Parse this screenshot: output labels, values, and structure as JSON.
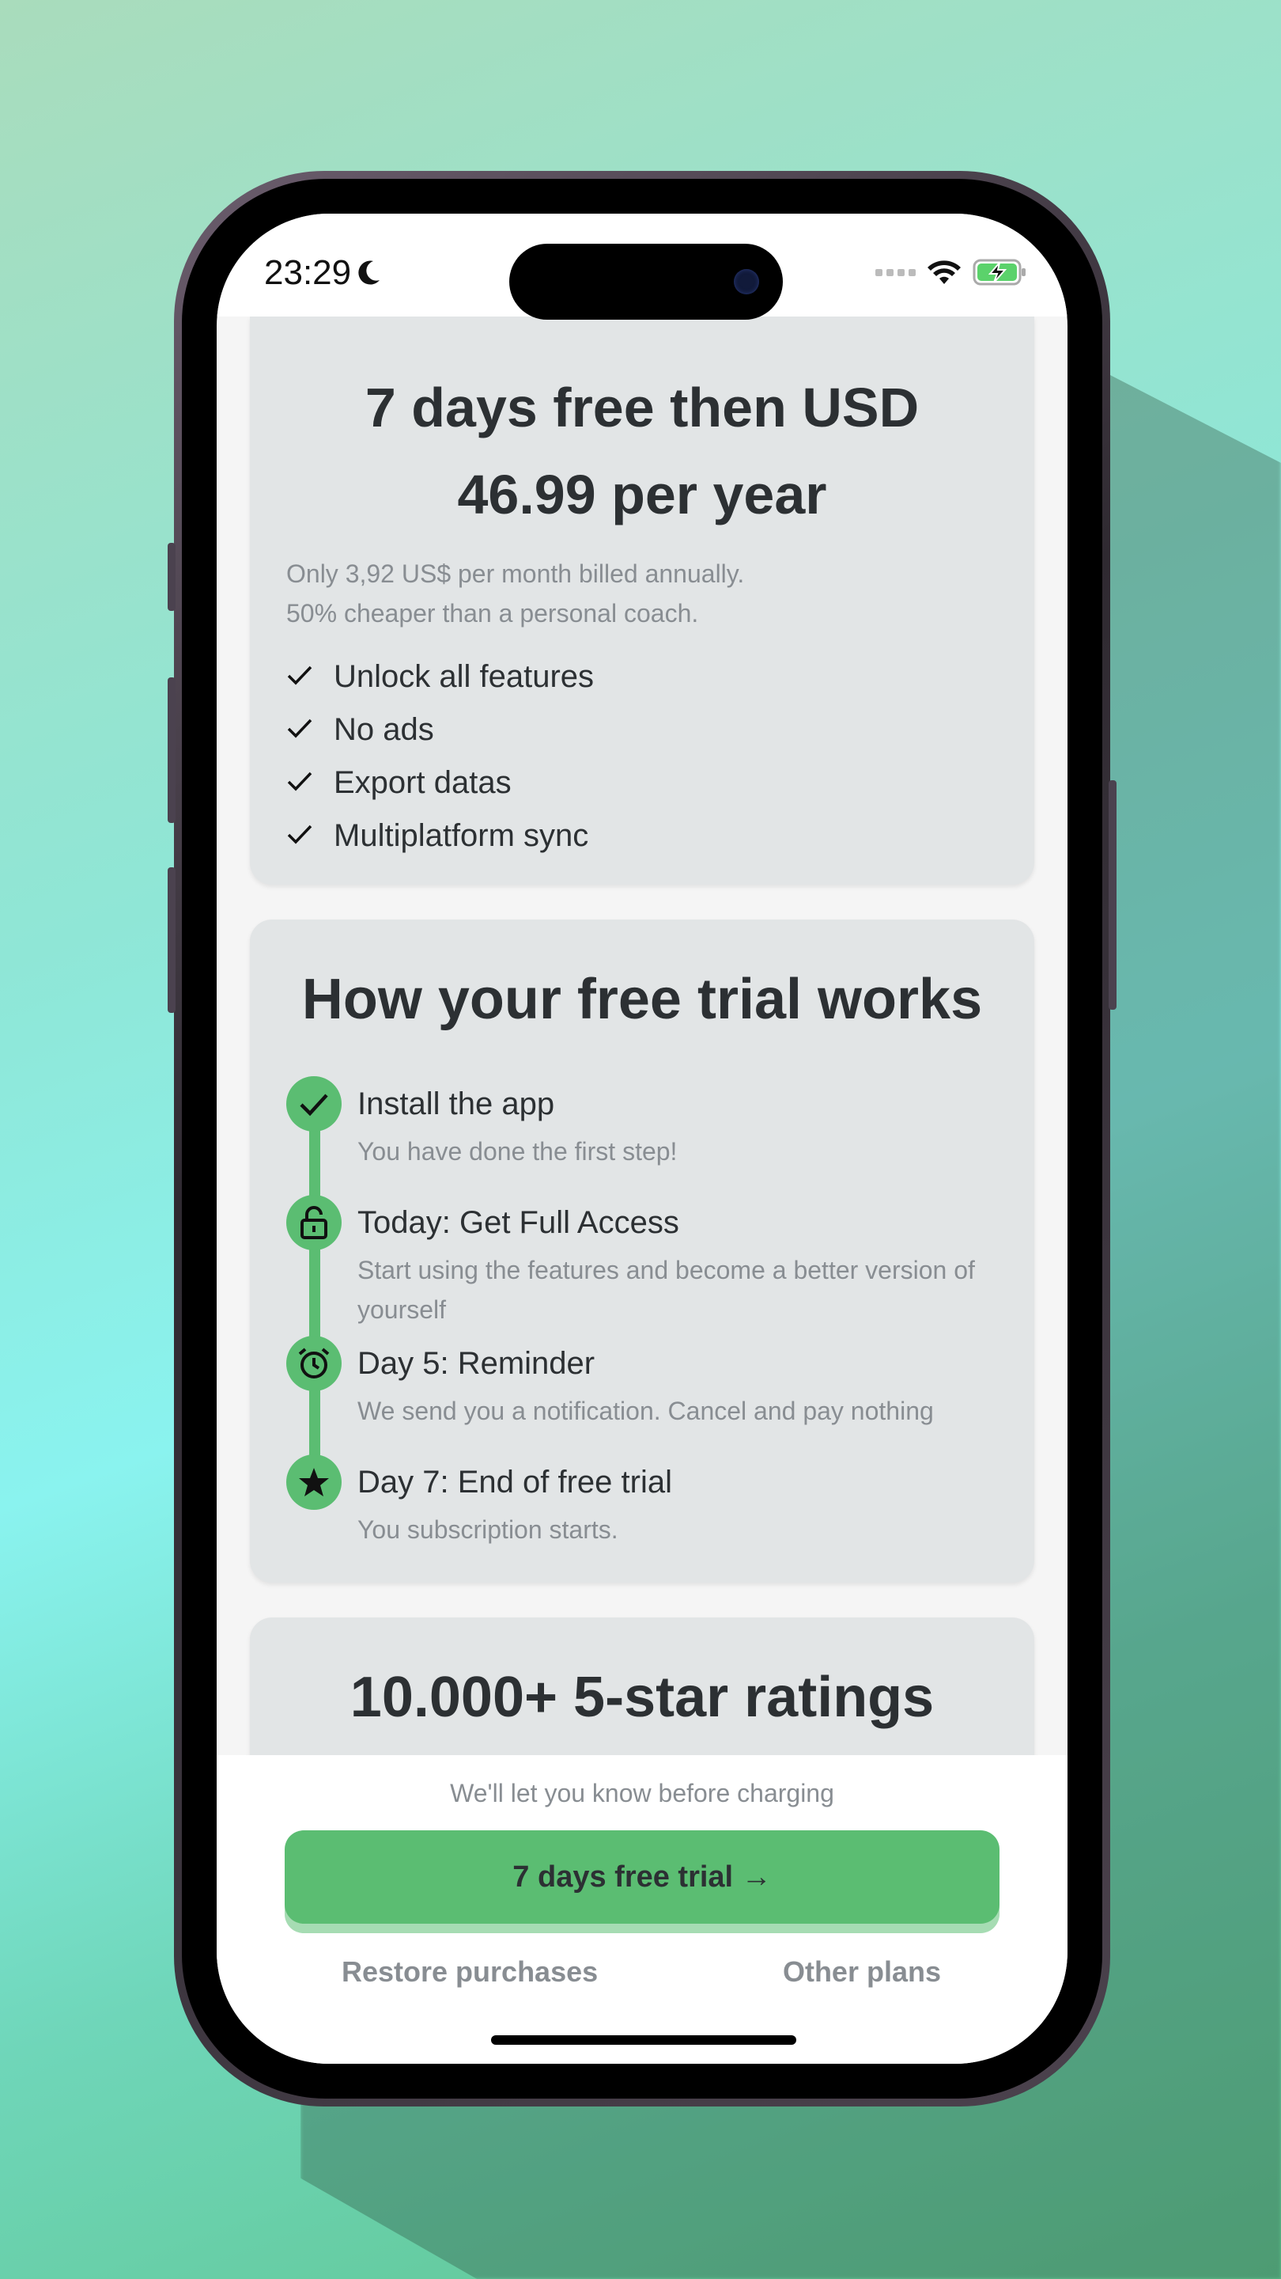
{
  "status_bar": {
    "time": "23:29"
  },
  "pricing": {
    "heading_line1": "7 days free then USD",
    "heading_line2": "46.99 per year",
    "subtitle_line1": "Only 3,92 US$ per month billed annually.",
    "subtitle_line2": "50% cheaper than a personal coach.",
    "features": [
      "Unlock all features",
      "No ads",
      "Export datas",
      "Multiplatform sync"
    ]
  },
  "trial": {
    "heading": "How your free trial works",
    "steps": [
      {
        "icon": "checkmark-icon",
        "title": "Install the app",
        "desc": "You have done the first step!"
      },
      {
        "icon": "unlock-icon",
        "title": "Today: Get Full Access",
        "desc": "Start using the features and become a better version of yourself"
      },
      {
        "icon": "alarm-clock-icon",
        "title": "Day 5: Reminder",
        "desc": "We send you a notification. Cancel and pay nothing"
      },
      {
        "icon": "star-icon",
        "title": "Day 7: End of free trial",
        "desc": "You subscription starts."
      }
    ]
  },
  "ratings": {
    "heading": "10.000+ 5-star ratings"
  },
  "footer": {
    "notice": "We'll let you know before charging",
    "cta_label": "7 days free trial →",
    "restore_label": "Restore purchases",
    "other_plans_label": "Other plans"
  },
  "colors": {
    "accent": "#5bbd72",
    "card": "#e2e5e6",
    "text": "#2c3033",
    "muted": "#888d92"
  }
}
